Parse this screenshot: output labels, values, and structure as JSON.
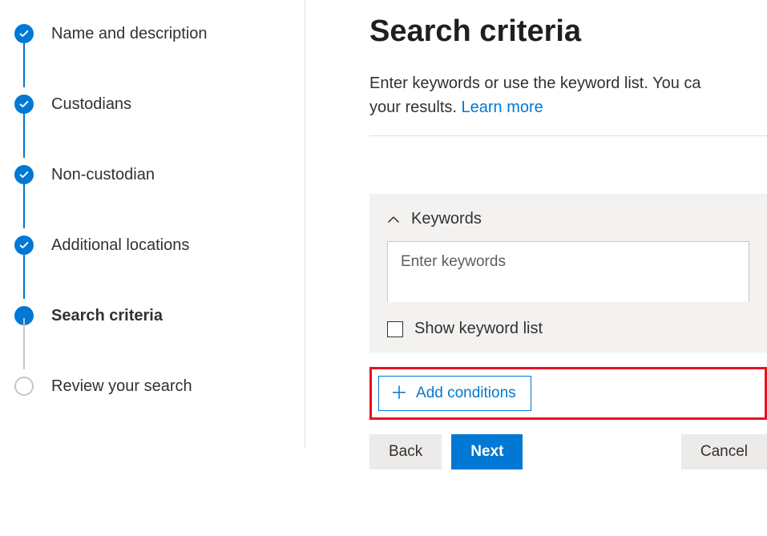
{
  "wizard": {
    "steps": [
      {
        "label": "Name and description",
        "state": "completed"
      },
      {
        "label": "Custodians",
        "state": "completed"
      },
      {
        "label": "Non-custodian",
        "state": "completed"
      },
      {
        "label": "Additional locations",
        "state": "completed"
      },
      {
        "label": "Search criteria",
        "state": "current"
      },
      {
        "label": "Review your search",
        "state": "upcoming"
      }
    ]
  },
  "page": {
    "title": "Search criteria",
    "description_prefix": "Enter keywords or use the keyword list. You ca",
    "description_suffix": "your results. ",
    "learn_more": "Learn more"
  },
  "keywords": {
    "header": "Keywords",
    "placeholder": "Enter keywords",
    "value": "",
    "show_list_label": "Show keyword list"
  },
  "actions": {
    "add_conditions": "Add conditions",
    "back": "Back",
    "next": "Next",
    "cancel": "Cancel"
  }
}
